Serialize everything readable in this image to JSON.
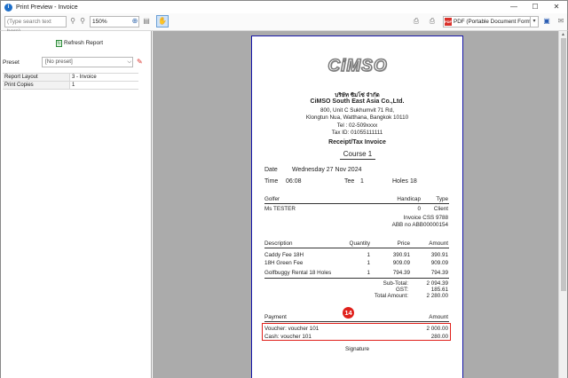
{
  "window": {
    "title": "Print Preview - Invoice",
    "minimize": "—",
    "maximize": "☐",
    "close": "✕"
  },
  "toolbar": {
    "search_placeholder": "(Type search text here)",
    "zoom": "150%",
    "export_format": "PDF (Portable Document Format)"
  },
  "left_panel": {
    "refresh_label": "Refresh Report",
    "preset_label": "Preset",
    "preset_value": "[No preset]",
    "properties": [
      {
        "key": "Report Layout",
        "value": "3 - Invoice"
      },
      {
        "key": "Print Copies",
        "value": "1"
      }
    ]
  },
  "invoice": {
    "logo": "CiMSO",
    "company_th": "บริษัท ซิมโซ่ จำกัด",
    "company_en": "CiMSO South East Asia Co.,Ltd.",
    "address_line1": "800, Unit C Sukhumvit 71 Rd,",
    "address_line2": "Klongtun Nua, Watthana, Bangkok 10110",
    "tel": "Tel : 02-509xxxx",
    "tax_id": "Tax ID: 01055111111",
    "doc_title": "Receipt/Tax Invoice",
    "course": "Course 1",
    "date_label": "Date",
    "date_value": "Wednesday 27 Nov 2024",
    "time_label": "Time",
    "time_value": "06:08",
    "tee_label": "Tee",
    "tee_value": "1",
    "holes_label": "Holes",
    "holes_value": "18",
    "golfer_header": "Golfer",
    "handicap_header": "Handicap",
    "type_header": "Type",
    "golfer_name": "Ms TESTER",
    "handicap_value": "0",
    "type_value": "Client",
    "invoice_no": "Invoice CSS 9788",
    "abb_no": "ABB no ABB00000154",
    "item_headers": {
      "description": "Description",
      "quantity": "Quantity",
      "price": "Price",
      "amount": "Amount"
    },
    "items": [
      {
        "description": "Caddy Fee 18H",
        "quantity": "1",
        "price": "390.91",
        "amount": "390.91"
      },
      {
        "description": "18H Green Fee",
        "quantity": "1",
        "price": "909.09",
        "amount": "909.09"
      },
      {
        "description": "Golfbuggy Rental 18 Holes",
        "quantity": "1",
        "price": "794.39",
        "amount": "794.39"
      }
    ],
    "subtotal_label": "Sub-Total:",
    "subtotal_value": "2 094.39",
    "gst_label": "GST:",
    "gst_value": "185.61",
    "total_label": "Total Amount:",
    "total_value": "2 280.00",
    "payment_header": "Payment",
    "payment_amount_header": "Amount",
    "callout_number": "14",
    "payments": [
      {
        "label": "Voucher: voucher 101",
        "amount": "2 000.00"
      },
      {
        "label": "Cash: voucher 101",
        "amount": "280.00"
      }
    ],
    "signature_label": "Signature"
  }
}
